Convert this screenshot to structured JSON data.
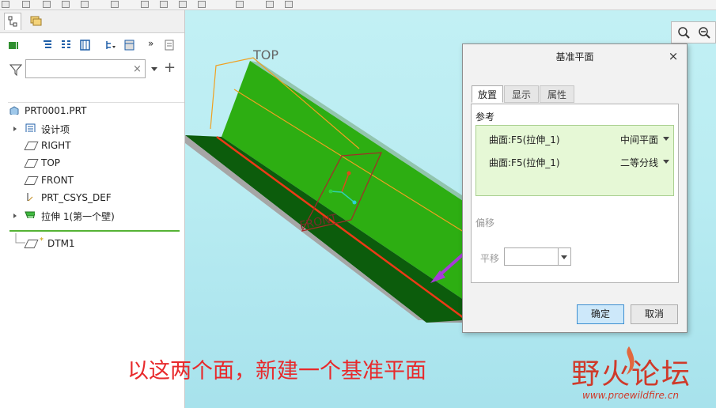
{
  "tree": {
    "root": "PRT0001.PRT",
    "items": [
      {
        "label": "设计项"
      },
      {
        "label": "RIGHT"
      },
      {
        "label": "TOP"
      },
      {
        "label": "FRONT"
      },
      {
        "label": "PRT_CSYS_DEF"
      },
      {
        "label": "拉伸 1(第一个壁)"
      },
      {
        "label": "DTM1"
      }
    ]
  },
  "viewport": {
    "plane_label": "TOP",
    "front_label": "FRONT"
  },
  "dialog": {
    "title": "基准平面",
    "tabs": [
      "放置",
      "显示",
      "属性"
    ],
    "references_label": "参考",
    "references": [
      {
        "name": "曲面:F5(拉伸_1)",
        "type": "中间平面"
      },
      {
        "name": "曲面:F5(拉伸_1)",
        "type": "二等分线"
      }
    ],
    "offset_label": "偏移",
    "translate_label": "平移",
    "translate_value": "",
    "ok_label": "确定",
    "cancel_label": "取消"
  },
  "caption": "以这两个面，新建一个基准平面",
  "watermark": {
    "name": "野火论坛",
    "url": "www.proewildfire.cn"
  },
  "colors": {
    "caption": "#e8292b",
    "accent_green": "#2fb410",
    "viewport_bg": "#b9ecf2"
  }
}
